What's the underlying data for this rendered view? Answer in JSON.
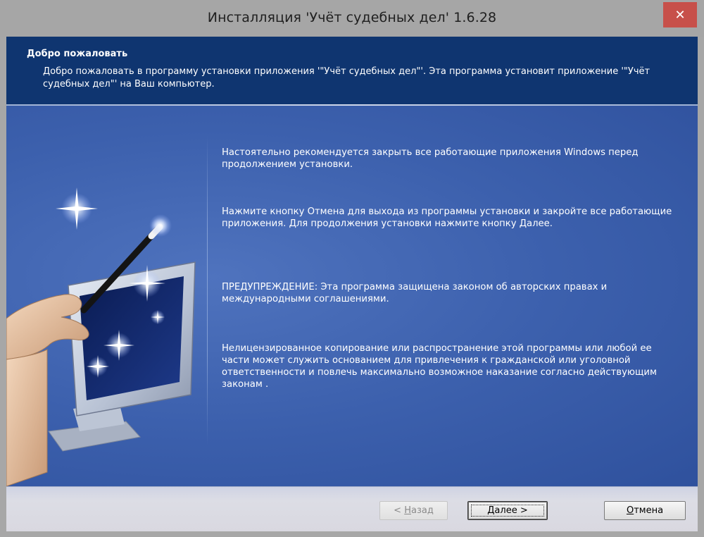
{
  "window": {
    "title": "Инсталляция 'Учёт судебных дел' 1.6.28",
    "close_glyph": "✕"
  },
  "header": {
    "title": "Добро пожаловать",
    "description": "Добро пожаловать в программу установки приложения '\"Учёт судебных дел\"'. Эта программа установит приложение '\"Учёт судебных дел\"' на Ваш компьютер."
  },
  "content": {
    "paragraphs": [
      "Настоятельно рекомендуется закрыть все работающие приложения Windows перед продолжением установки.",
      "Нажмите кнопку Отмена для выхода из программы установки и закройте все работающие приложения. Для продолжения установки нажмите кнопку Далее.",
      "ПРЕДУПРЕЖДЕНИЕ: Эта программа защищена законом об авторских правах и международными соглашениями.",
      "Нелицензированное копирование или распространение этой программы или любой ее части может служить основанием для привлечения к гражданской или уголовной ответственности и повлечь максимально возможное наказание согласно действующим законам ."
    ]
  },
  "buttons": {
    "back": {
      "prefix": "< ",
      "accel": "Н",
      "rest": "азад",
      "enabled": false
    },
    "next": {
      "accel": "Д",
      "rest": "алее",
      "suffix": " >",
      "default": true
    },
    "cancel": {
      "accel": "О",
      "rest": "тмена"
    }
  },
  "icons": {
    "illustration": "magic-wand-monitor-illustration",
    "close": "close-icon"
  },
  "colors": {
    "header_bg": "#0f3570",
    "body_bg": "#3c60ad",
    "close_bg": "#c7504a"
  }
}
